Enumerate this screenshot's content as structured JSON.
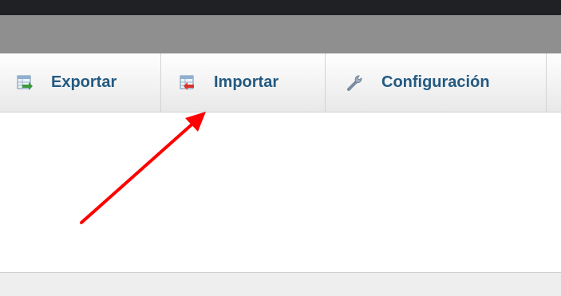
{
  "tabs": [
    {
      "label": "Exportar",
      "icon": "table-export-icon"
    },
    {
      "label": "Importar",
      "icon": "table-import-icon"
    },
    {
      "label": "Configuración",
      "icon": "wrench-icon"
    }
  ],
  "colors": {
    "tab_text": "#235a81",
    "arrow": "#ff0000"
  }
}
